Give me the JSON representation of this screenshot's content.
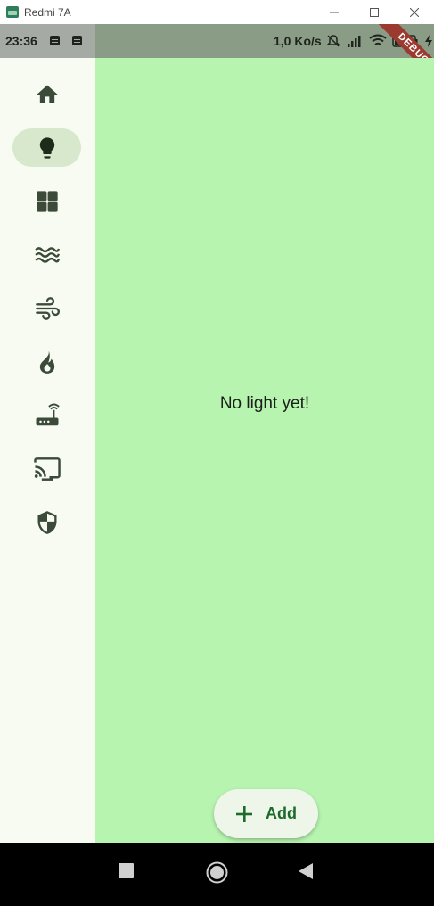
{
  "window": {
    "title": "Redmi 7A",
    "controls": [
      "minimize-icon",
      "maximize-icon",
      "close-icon"
    ]
  },
  "status_bar": {
    "time": "23:36",
    "network_speed": "1,0 Ko/s",
    "icons": [
      "notification-icon",
      "notification-icon",
      "mute-icon",
      "signal-icon",
      "wifi-icon",
      "battery-icon",
      "charging-icon"
    ],
    "debug_banner": "DEBUG"
  },
  "nav_rail": {
    "items": [
      {
        "icon": "home-icon",
        "selected": false
      },
      {
        "icon": "lightbulb-icon",
        "selected": true
      },
      {
        "icon": "dashboard-icon",
        "selected": false
      },
      {
        "icon": "waves-icon",
        "selected": false
      },
      {
        "icon": "air-icon",
        "selected": false
      },
      {
        "icon": "fire-icon",
        "selected": false
      },
      {
        "icon": "router-icon",
        "selected": false
      },
      {
        "icon": "cast-icon",
        "selected": false
      },
      {
        "icon": "shield-icon",
        "selected": false
      }
    ]
  },
  "main": {
    "empty_message": "No light yet!"
  },
  "fab": {
    "label": "Add",
    "icon": "plus-icon"
  },
  "android_nav": {
    "buttons": [
      "recents-icon",
      "home-circle-icon",
      "back-icon"
    ]
  },
  "colors": {
    "content_bg": "#b7f4b0",
    "rail_bg": "#f7fbf1",
    "rail_active": "#d7e8cd",
    "fab_bg": "#edf6e9",
    "fab_text": "#1d6a2a",
    "icon": "#3b4a39"
  }
}
